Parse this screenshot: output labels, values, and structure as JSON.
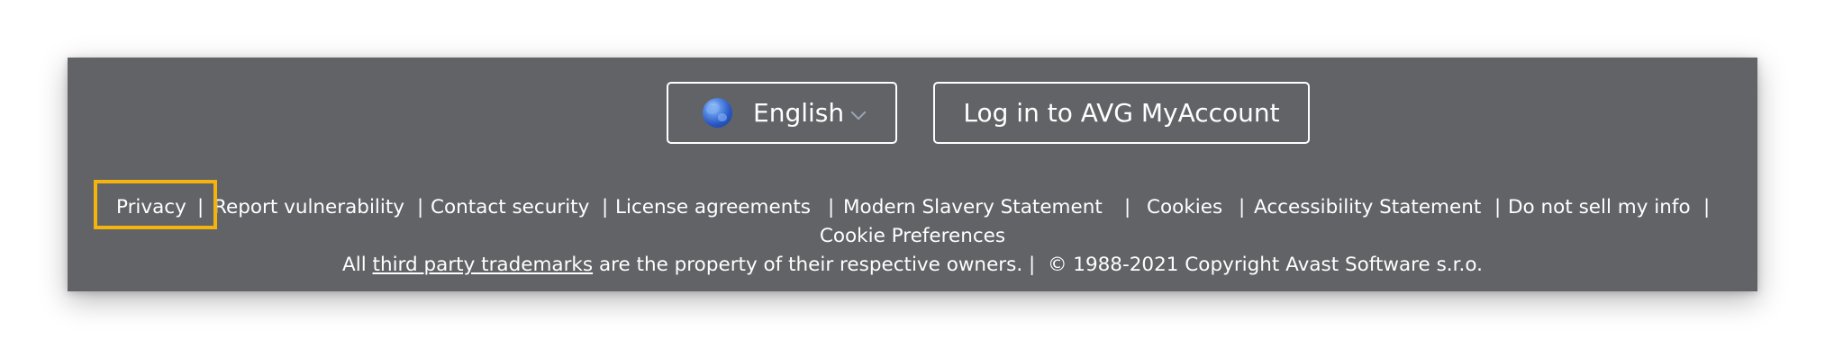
{
  "footer": {
    "language_button": {
      "label": "English",
      "icon": "globe-icon"
    },
    "login_button": {
      "label": "Log in to AVG MyAccount"
    },
    "links": [
      {
        "label": "Privacy"
      },
      {
        "label": "Report vulnerability"
      },
      {
        "label": "Contact security"
      },
      {
        "label": "License agreements"
      },
      {
        "label": "Modern Slavery Statement"
      },
      {
        "label": "Cookies"
      },
      {
        "label": "Accessibility Statement"
      },
      {
        "label": "Do not sell my info"
      },
      {
        "label": "Cookie Preferences"
      }
    ],
    "separator": "|",
    "legal": {
      "prefix": "All",
      "link": "third party trademarks",
      "middle": "are the property of their respective owners.",
      "separator": "|",
      "copyright": "© 1988-2021 Copyright Avast Software s.r.o."
    }
  },
  "annotation": {
    "highlight_color": "#f5b40d",
    "highlighted_item": "Privacy"
  },
  "colors": {
    "footer_bg": "#626367",
    "text": "#ffffff"
  }
}
